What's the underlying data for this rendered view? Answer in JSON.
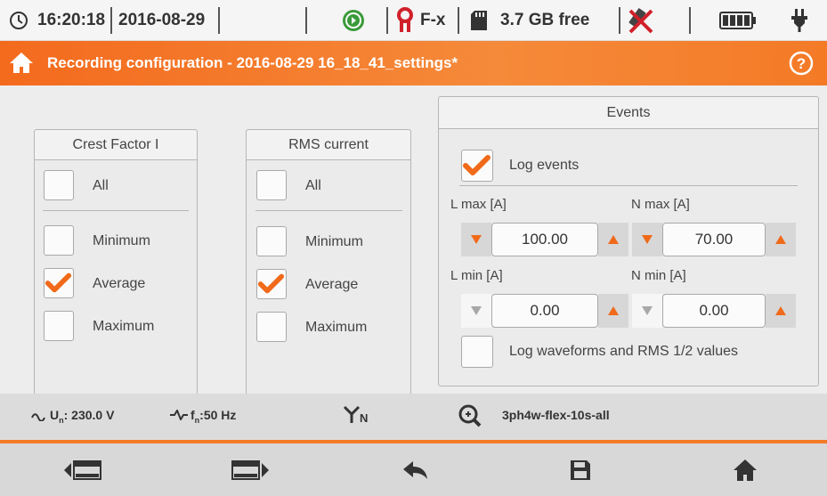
{
  "status": {
    "time": "16:20:18",
    "date": "2016-08-29",
    "flex": "F-x",
    "storage": "3.7 GB free"
  },
  "title": "Recording configuration - 2016-08-29 16_18_41_settings*",
  "crest": {
    "title": "Crest Factor I",
    "all": {
      "label": "All",
      "checked": false
    },
    "items": [
      {
        "label": "Minimum",
        "checked": false
      },
      {
        "label": "Average",
        "checked": true
      },
      {
        "label": "Maximum",
        "checked": false
      }
    ]
  },
  "rms": {
    "title": "RMS current",
    "all": {
      "label": "All",
      "checked": false
    },
    "items": [
      {
        "label": "Minimum",
        "checked": false
      },
      {
        "label": "Average",
        "checked": true
      },
      {
        "label": "Maximum",
        "checked": false
      }
    ]
  },
  "events": {
    "title": "Events",
    "log_events": {
      "label": "Log events",
      "checked": true
    },
    "lmax": {
      "label": "L max [A]",
      "value": "100.00"
    },
    "nmax": {
      "label": "N max [A]",
      "value": "70.00"
    },
    "lmin": {
      "label": "L min [A]",
      "value": "0.00"
    },
    "nmin": {
      "label": "N min [A]",
      "value": "0.00"
    },
    "log_waveforms": {
      "label": "Log waveforms and RMS 1/2 values",
      "checked": false
    }
  },
  "info": {
    "voltage_label": "U",
    "voltage_sub": "n",
    "voltage_value": ": 230.0 V",
    "freq_label": "f",
    "freq_sub": "n",
    "freq_value": ":50 Hz",
    "config_sub": "N",
    "config_name": "3ph4w-flex-10s-all"
  },
  "colors": {
    "accent": "#f47a26",
    "check": "#f06a1a"
  }
}
